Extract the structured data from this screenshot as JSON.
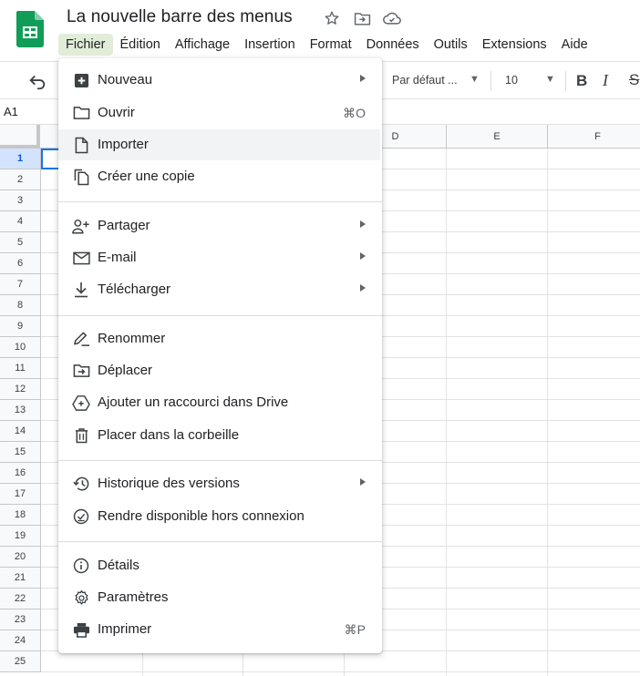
{
  "document": {
    "title": "La nouvelle barre des menus"
  },
  "menubar": [
    "Fichier",
    "Édition",
    "Affichage",
    "Insertion",
    "Format",
    "Données",
    "Outils",
    "Extensions",
    "Aide"
  ],
  "menubar_active": "Fichier",
  "toolbar": {
    "font": "Par défaut ...",
    "font_size": "10",
    "bold": "B",
    "italic": "I",
    "strike": "S"
  },
  "namebox": "A1",
  "columns": [
    "D",
    "E",
    "F"
  ],
  "rows": [
    "1",
    "2",
    "3",
    "4",
    "5",
    "6",
    "7",
    "8",
    "9",
    "10",
    "11",
    "12",
    "13",
    "14",
    "15",
    "16",
    "17",
    "18",
    "19",
    "20",
    "21",
    "22",
    "23",
    "24",
    "25"
  ],
  "selected_cell": "A1",
  "file_menu": {
    "items": [
      {
        "label": "Nouveau",
        "icon": "plus-box-icon",
        "submenu": true
      },
      {
        "label": "Ouvrir",
        "icon": "folder-icon",
        "shortcut": "⌘O"
      },
      {
        "label": "Importer",
        "icon": "file-icon"
      },
      {
        "label": "Créer une copie",
        "icon": "copy-icon"
      },
      {
        "label": "Partager",
        "icon": "person-add-icon",
        "submenu": true
      },
      {
        "label": "E-mail",
        "icon": "mail-icon",
        "submenu": true
      },
      {
        "label": "Télécharger",
        "icon": "download-icon",
        "submenu": true
      },
      {
        "label": "Renommer",
        "icon": "rename-icon"
      },
      {
        "label": "Déplacer",
        "icon": "move-folder-icon"
      },
      {
        "label": "Ajouter un raccourci dans Drive",
        "icon": "drive-shortcut-icon"
      },
      {
        "label": "Placer dans la corbeille",
        "icon": "trash-icon"
      },
      {
        "label": "Historique des versions",
        "icon": "history-icon",
        "submenu": true
      },
      {
        "label": "Rendre disponible hors connexion",
        "icon": "offline-icon"
      },
      {
        "label": "Détails",
        "icon": "info-icon"
      },
      {
        "label": "Paramètres",
        "icon": "gear-icon"
      },
      {
        "label": "Imprimer",
        "icon": "print-icon",
        "shortcut": "⌘P"
      }
    ],
    "hovered_item": "Importer"
  },
  "colors": {
    "accent": "#1a73e8",
    "menu_active_bg": "#e2edd9",
    "sheets_green": "#0f9d58"
  }
}
